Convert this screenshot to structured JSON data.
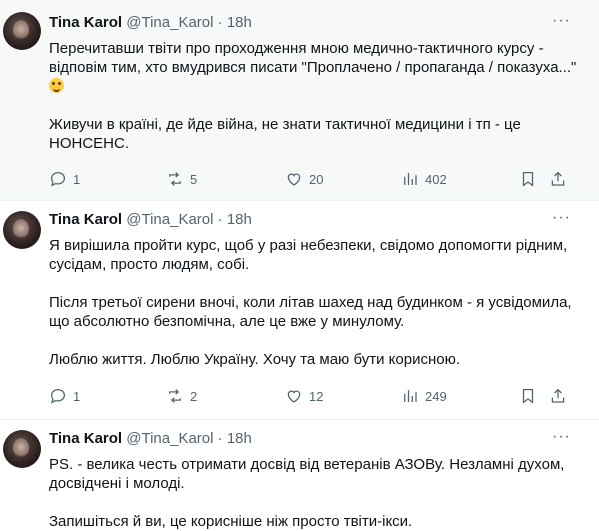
{
  "tweets": [
    {
      "name": "Tina Karol",
      "handle": "@Tina_Karol",
      "dot": "·",
      "time": "18h",
      "more": "···",
      "paragraphs": [
        "Перечитавши твіти про проходження мною медично-тактичного курсу - відповім тим, хто вмудрився писати \"Проплачено / пропаганда / показуха...\"",
        "Живучи в країні, де йде війна, не знати тактичної медицини і тп  - це НОНСЕНС."
      ],
      "emoji": "winking-face-with-tongue-icon",
      "actions": {
        "replies": "1",
        "reposts": "5",
        "likes": "20",
        "views": "402"
      }
    },
    {
      "name": "Tina Karol",
      "handle": "@Tina_Karol",
      "dot": "·",
      "time": "18h",
      "more": "···",
      "paragraphs": [
        "Я вирішила пройти курс, щоб у разі небезпеки, свідомо допомогти рідним, сусідам, просто людям, собі.",
        "Після третьої сирени вночі, коли літав шахед над будинком - я усвідомила, що абсолютно безпомічна, але це вже у минулому.",
        "Люблю життя. Люблю Україну. Хочу та маю бути корисною."
      ],
      "actions": {
        "replies": "1",
        "reposts": "2",
        "likes": "12",
        "views": "249"
      }
    },
    {
      "name": "Tina Karol",
      "handle": "@Tina_Karol",
      "dot": "·",
      "time": "18h",
      "more": "···",
      "paragraphs": [
        "PS. - велика честь отримати досвід від ветеранів АЗОВу. Незламні духом, досвідчені і молоді.",
        "Запишіться й ви, це корисніше ніж просто твіти-ікси."
      ]
    }
  ],
  "colors": {
    "text": "#0f1419",
    "secondary": "#536471",
    "highlight_bg": "#f7f9f9",
    "divider": "#eff3f4"
  }
}
